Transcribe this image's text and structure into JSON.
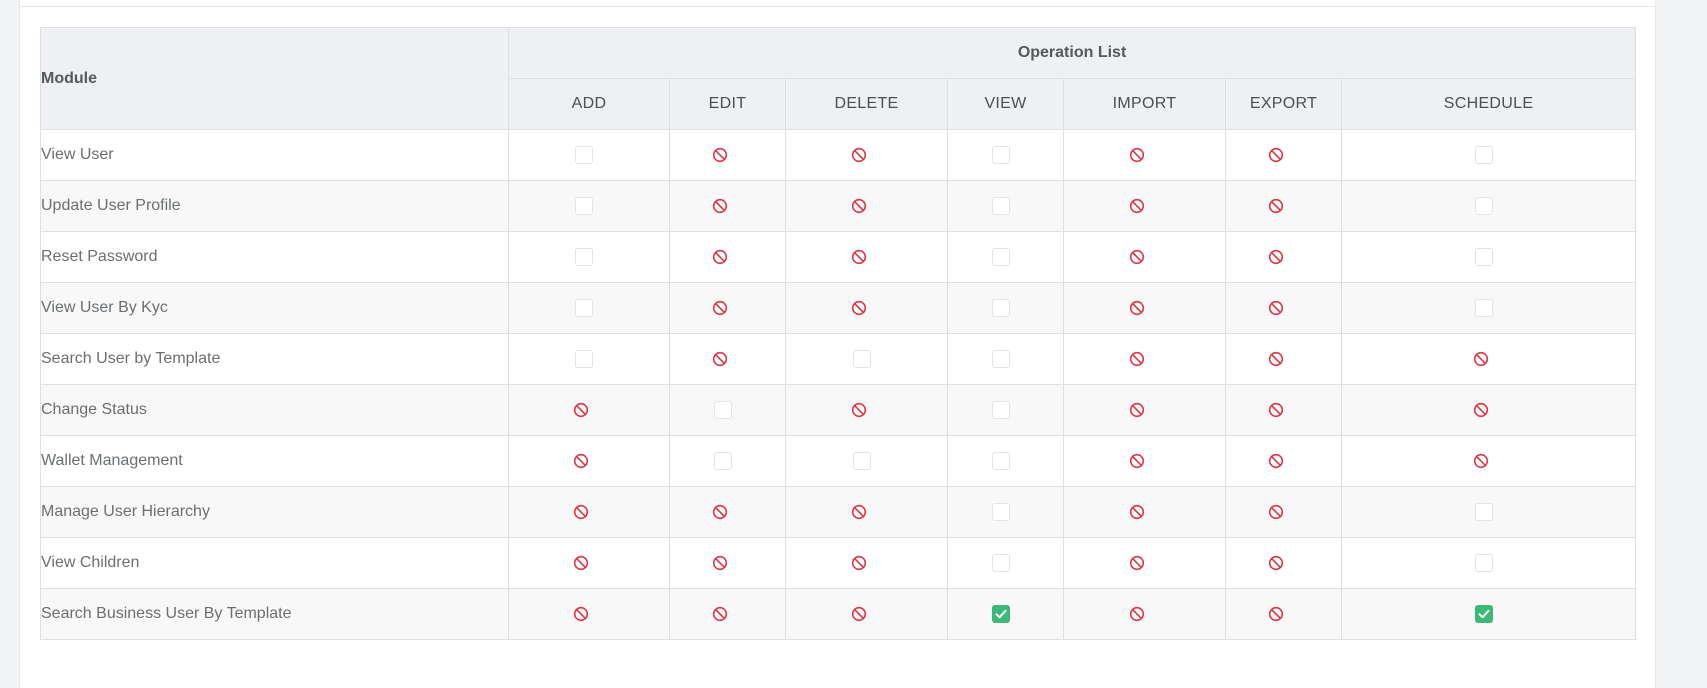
{
  "table": {
    "module_header": "Module",
    "operation_list_header": "Operation List",
    "operations": [
      "ADD",
      "EDIT",
      "DELETE",
      "VIEW",
      "IMPORT",
      "EXPORT",
      "SCHEDULE"
    ],
    "rows": [
      {
        "module": "View User",
        "cells": [
          "unchecked",
          "denied",
          "denied",
          "unchecked",
          "denied",
          "denied",
          "unchecked"
        ]
      },
      {
        "module": "Update User Profile",
        "cells": [
          "unchecked",
          "denied",
          "denied",
          "unchecked",
          "denied",
          "denied",
          "unchecked"
        ]
      },
      {
        "module": "Reset Password",
        "cells": [
          "unchecked",
          "denied",
          "denied",
          "unchecked",
          "denied",
          "denied",
          "unchecked"
        ]
      },
      {
        "module": "View User By Kyc",
        "cells": [
          "unchecked",
          "denied",
          "denied",
          "unchecked",
          "denied",
          "denied",
          "unchecked"
        ]
      },
      {
        "module": "Search User by Template",
        "cells": [
          "unchecked",
          "denied",
          "unchecked",
          "unchecked",
          "denied",
          "denied",
          "denied"
        ]
      },
      {
        "module": "Change Status",
        "cells": [
          "denied",
          "unchecked",
          "denied",
          "unchecked",
          "denied",
          "denied",
          "denied"
        ]
      },
      {
        "module": "Wallet Management",
        "cells": [
          "denied",
          "unchecked",
          "unchecked",
          "unchecked",
          "denied",
          "denied",
          "denied"
        ]
      },
      {
        "module": "Manage User Hierarchy",
        "cells": [
          "denied",
          "denied",
          "denied",
          "unchecked",
          "denied",
          "denied",
          "unchecked"
        ]
      },
      {
        "module": "View Children",
        "cells": [
          "denied",
          "denied",
          "denied",
          "unchecked",
          "denied",
          "denied",
          "unchecked"
        ]
      },
      {
        "module": "Search Business User By Template",
        "cells": [
          "denied",
          "denied",
          "denied",
          "checked",
          "denied",
          "denied",
          "checked"
        ]
      }
    ]
  },
  "colors": {
    "checked": "#3cb878",
    "denied": "#dc3545",
    "header_bg": "#eef0f3",
    "border": "#dcdfe4"
  },
  "icons": {
    "denied": "ban-icon",
    "checked": "check-icon"
  }
}
